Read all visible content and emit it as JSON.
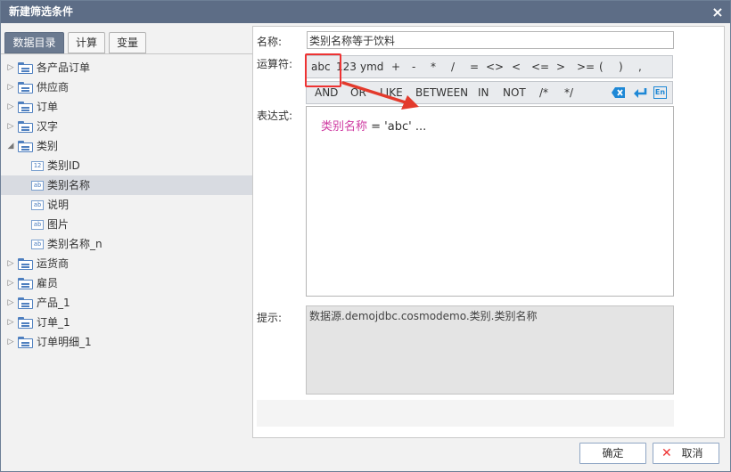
{
  "window": {
    "title": "新建筛选条件",
    "close_icon": "close-icon"
  },
  "tabs": [
    {
      "label": "数据目录",
      "active": true
    },
    {
      "label": "计算",
      "active": false
    },
    {
      "label": "变量",
      "active": false
    }
  ],
  "tree": {
    "items": [
      {
        "label": "各产品订单",
        "type": "folder",
        "expanded": false
      },
      {
        "label": "供应商",
        "type": "folder",
        "expanded": false
      },
      {
        "label": "订单",
        "type": "folder",
        "expanded": false
      },
      {
        "label": "汉字",
        "type": "folder",
        "expanded": false
      },
      {
        "label": "类别",
        "type": "folder",
        "expanded": true
      },
      {
        "label": "类别ID",
        "type": "number-field",
        "icon_text": "12"
      },
      {
        "label": "类别名称",
        "type": "text-field",
        "icon_text": "ab",
        "selected": true
      },
      {
        "label": "说明",
        "type": "text-field",
        "icon_text": "ab"
      },
      {
        "label": "图片",
        "type": "text-field",
        "icon_text": "ab"
      },
      {
        "label": "类别名称_n",
        "type": "text-field",
        "icon_text": "ab"
      },
      {
        "label": "运货商",
        "type": "folder",
        "expanded": false
      },
      {
        "label": "雇员",
        "type": "folder",
        "expanded": false
      },
      {
        "label": "产品_1",
        "type": "folder",
        "expanded": false
      },
      {
        "label": "订单_1",
        "type": "folder",
        "expanded": false
      },
      {
        "label": "订单明细_1",
        "type": "folder",
        "expanded": false
      }
    ]
  },
  "form": {
    "name_label": "名称:",
    "name_value": "类别名称等于饮料",
    "operator_label": "运算符:",
    "operators_row1": [
      "abc",
      "123",
      "ymd",
      "+",
      "-",
      "*",
      "/",
      "=",
      "<>",
      "<",
      "<=",
      ">",
      ">=",
      "(",
      ")",
      ","
    ],
    "operators_row2": [
      "AND",
      "OR",
      "LIKE",
      "BETWEEN",
      "IN",
      "NOT",
      "/*",
      "*/"
    ],
    "controls": [
      "clear-icon",
      "enter-icon",
      "en-icon"
    ],
    "en_text": "En",
    "expression_label": "表达式:",
    "expression": {
      "field": "类别名称",
      "rest": " = 'abc' ..."
    },
    "hint_label": "提示:",
    "hint_value": "数据源.demojdbc.cosmodemo.类别.类别名称"
  },
  "buttons": {
    "ok": "确定",
    "cancel": "取消"
  },
  "colors": {
    "titlebar": "#5d6d86",
    "field_color": "#cf3ca2",
    "highlight": "#ee3333",
    "arrow": "#e33a2c",
    "icon_blue": "#1e88d6"
  }
}
